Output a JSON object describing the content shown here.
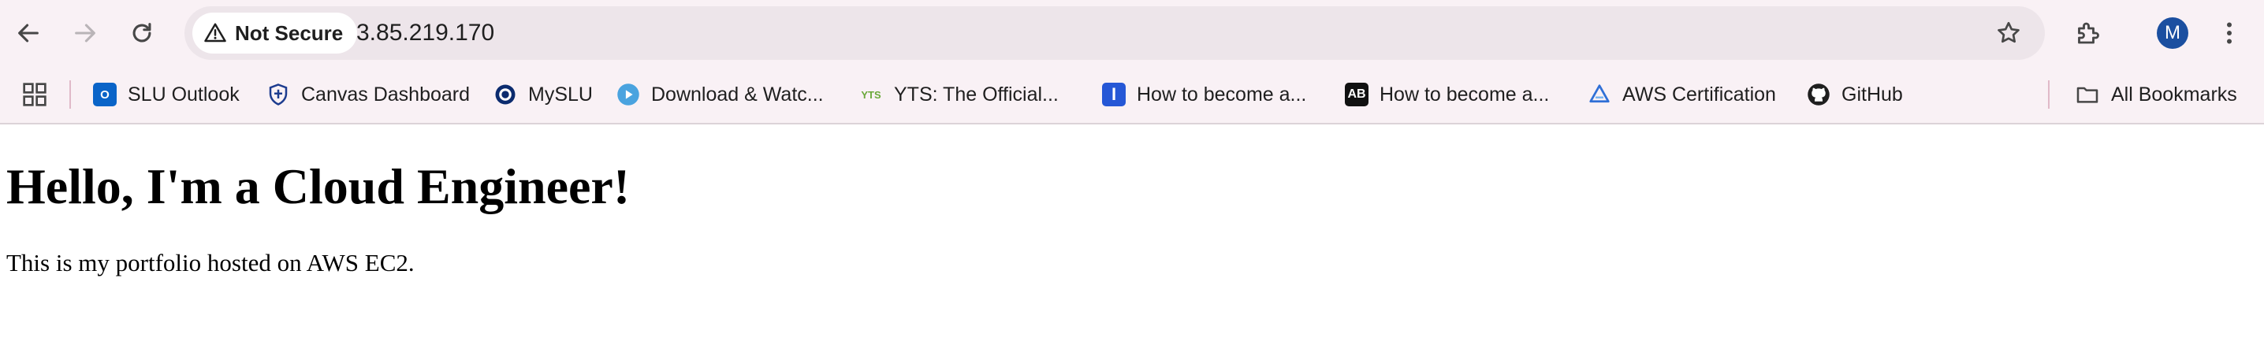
{
  "toolbar": {
    "security_label": "Not Secure",
    "url": "3.85.219.170",
    "profile_initial": "M"
  },
  "bookmarks": [
    {
      "label": "SLU Outlook",
      "icon": "outlook-icon"
    },
    {
      "label": "Canvas Dashboard",
      "icon": "shield-crest-icon"
    },
    {
      "label": "MySLU",
      "icon": "myslu-circle-icon"
    },
    {
      "label": "Download & Watc...",
      "icon": "play-icon"
    },
    {
      "label": "YTS: The Official...",
      "icon": "yts-icon"
    },
    {
      "label": "How to become a...",
      "icon": "indeed-icon"
    },
    {
      "label": "How to become a...",
      "icon": "ab-icon"
    },
    {
      "label": "AWS Certification",
      "icon": "aws-icon"
    },
    {
      "label": "GitHub",
      "icon": "github-icon"
    }
  ],
  "all_bookmarks_label": "All Bookmarks",
  "page": {
    "heading": "Hello, I'm a Cloud Engineer!",
    "text": "This is my portfolio hosted on AWS EC2."
  }
}
